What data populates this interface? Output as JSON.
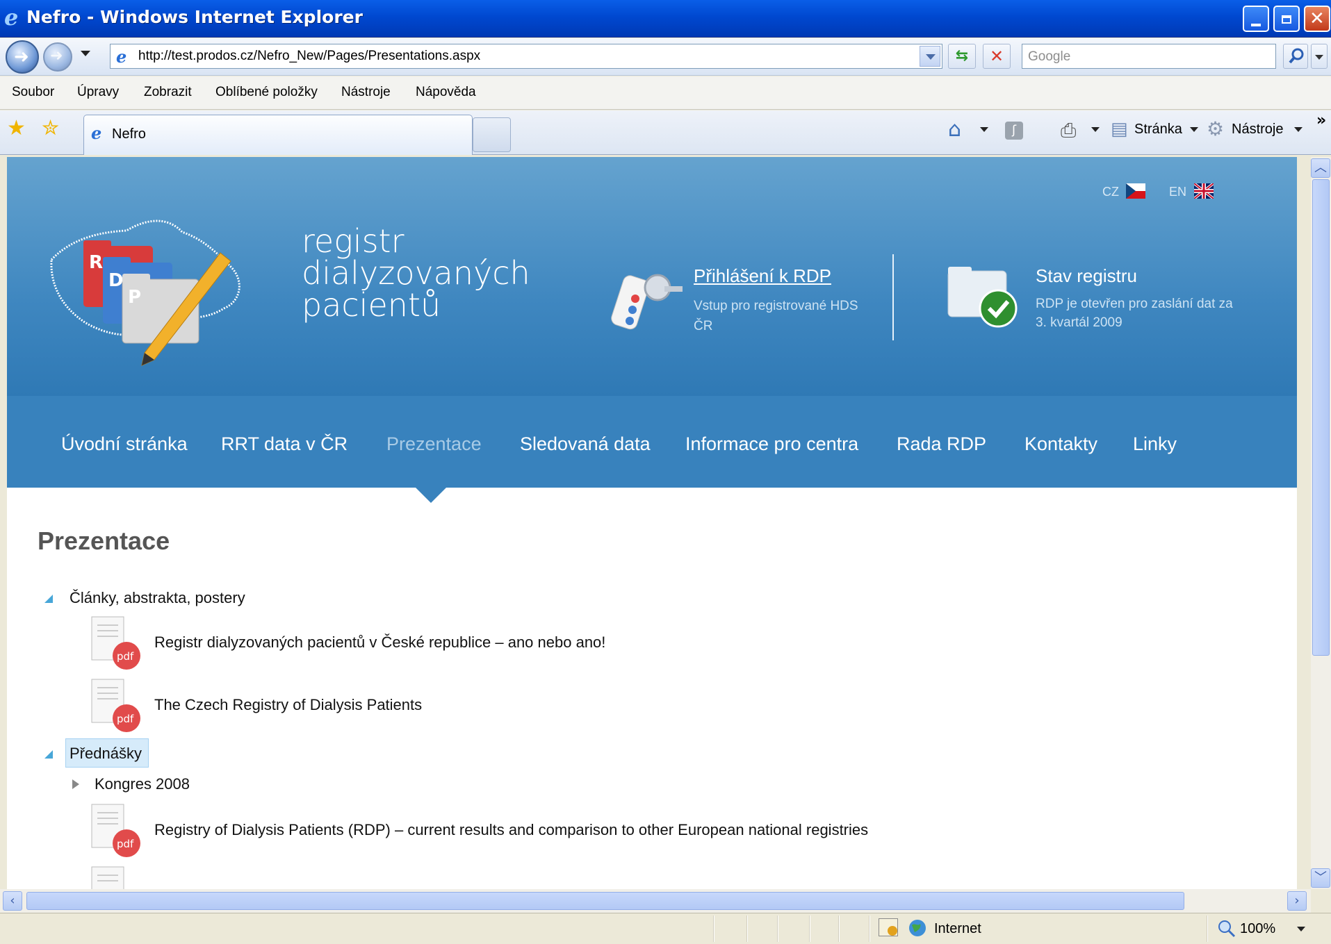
{
  "window": {
    "title": "Nefro - Windows Internet Explorer"
  },
  "address": {
    "url": "http://test.prodos.cz/Nefro_New/Pages/Presentations.aspx",
    "search_placeholder": "Google"
  },
  "menu": {
    "items": [
      "Soubor",
      "Úpravy",
      "Zobrazit",
      "Oblíbené položky",
      "Nástroje",
      "Nápověda"
    ]
  },
  "tabs": {
    "active": "Nefro"
  },
  "toolbar": {
    "page_label": "Stránka",
    "tools_label": "Nástroje"
  },
  "site": {
    "lang_cz": "CZ",
    "lang_en": "EN",
    "brand": [
      "registr",
      "dialyzovaných",
      "pacientů"
    ],
    "logo_letters": [
      "R",
      "D",
      "P"
    ],
    "login_link": "Přihlášení k RDP",
    "login_desc": "Vstup pro registrované HDS ČR",
    "status_title": "Stav registru",
    "status_desc": "RDP je otevřen pro zaslání dat za 3. kvartál 2009",
    "nav": [
      "Úvodní stránka",
      "RRT data v ČR",
      "Prezentace",
      "Sledovaná data",
      "Informace pro centra",
      "Rada RDP",
      "Kontakty",
      "Linky"
    ],
    "active_nav": "Prezentace"
  },
  "page": {
    "title": "Prezentace",
    "pdf_label": "pdf",
    "tree": {
      "group1": {
        "label": "Články, abstrakta, postery",
        "items": [
          "Registr dialyzovaných pacientů v České republice – ano nebo ano!",
          "The Czech Registry of Dialysis Patients"
        ]
      },
      "group2": {
        "label": "Přednášky",
        "subgroup": "Kongres 2008",
        "items": [
          "Registry of Dialysis Patients (RDP) – current results and comparison to other European national registries"
        ]
      }
    }
  },
  "statusbar": {
    "zone": "Internet",
    "zoom": "100%"
  },
  "colors": {
    "titlebar": "#0048d0",
    "header_blue": "#3882bd",
    "active_nav": "#a8cbe6",
    "pdf_red": "#e14b4b"
  }
}
